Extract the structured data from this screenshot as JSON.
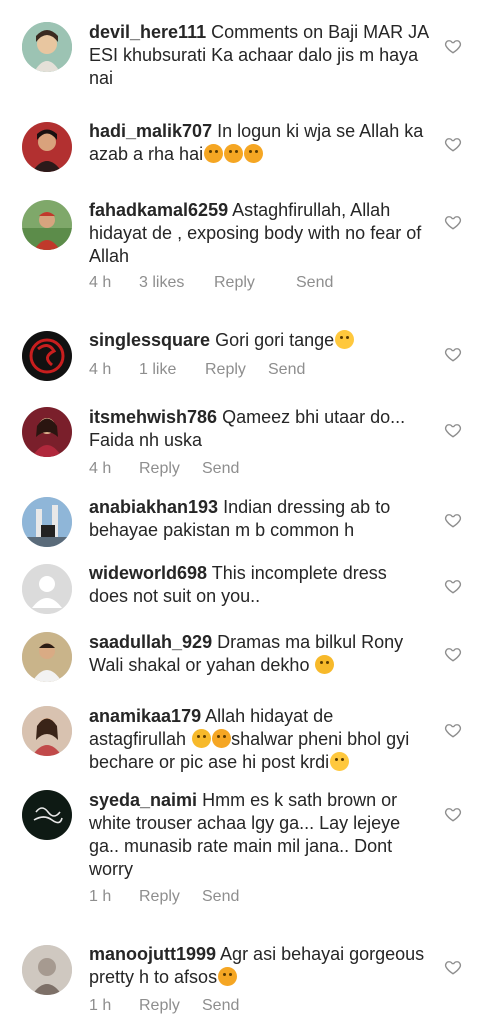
{
  "comments": [
    {
      "username": "devil_here111",
      "text": "Comments on Baji MAR JA ESI khubsurati Ka achaar dalo jis m haya nai",
      "emoji": [],
      "time": "",
      "likes": "",
      "reply": "",
      "send": ""
    },
    {
      "username": "hadi_malik707",
      "text": "In logun ki wja se Allah ka azab a rha hai",
      "emoji": [
        "crying-face",
        "crying-face",
        "crying-face"
      ],
      "time": "",
      "likes": "",
      "reply": "",
      "send": ""
    },
    {
      "username": "fahadkamal6259",
      "text": "Astaghfirullah, Allah hidayat de , exposing body with no fear of Allah",
      "emoji": [],
      "time": "4 h",
      "likes": "3 likes",
      "reply": "Reply",
      "send": "Send"
    },
    {
      "username": "singlessquare",
      "text": "Gori gori tange",
      "emoji": [
        "laughing-face"
      ],
      "time": "4 h",
      "likes": "1 like",
      "reply": "Reply",
      "send": "Send"
    },
    {
      "username": "itsmehwish786",
      "text": "Qameez bhi utaar do... Faida nh uska",
      "emoji": [],
      "time": "4 h",
      "likes": "",
      "reply": "Reply",
      "send": "Send"
    },
    {
      "username": "anabiakhan193",
      "text": "Indian dressing ab to behayae pakistan m b common h",
      "emoji": [],
      "time": "",
      "likes": "",
      "reply": "",
      "send": ""
    },
    {
      "username": "wideworld698",
      "text": "This incomplete dress does not suit on you..",
      "emoji": [],
      "time": "",
      "likes": "",
      "reply": "",
      "send": ""
    },
    {
      "username": "saadullah_929",
      "text": "Dramas ma bilkul Rony Wali shakal or yahan dekho",
      "emoji": [
        "winking-tongue-face"
      ],
      "time": "",
      "likes": "",
      "reply": "",
      "send": ""
    },
    {
      "username": "anamikaa179",
      "text": "Allah hidayat de astagfirullah",
      "emoji": [
        "astonished-face",
        "crying-face"
      ],
      "text_after": "shalwar pheni bhol gyi bechare or pic ase hi post krdi",
      "emoji_after": [
        "laughing-face"
      ],
      "time": "",
      "likes": "",
      "reply": "",
      "send": ""
    },
    {
      "username": "syeda_naimi",
      "text": "Hmm es k sath  brown or white trouser achaa lgy ga... Lay lejeye ga.. munasib rate main mil jana.. Dont worry",
      "emoji": [],
      "time": "1 h",
      "likes": "",
      "reply": "Reply",
      "send": "Send"
    },
    {
      "username": "manoojutt1999",
      "text": "Agr asi behayai gorgeous pretty h to afsos",
      "emoji": [
        "crying-face"
      ],
      "time": "1 h",
      "likes": "",
      "reply": "Reply",
      "send": "Send"
    }
  ],
  "colors": {
    "text": "#262626",
    "meta": "#8e8e8e",
    "emoji": "#f7b92a"
  }
}
